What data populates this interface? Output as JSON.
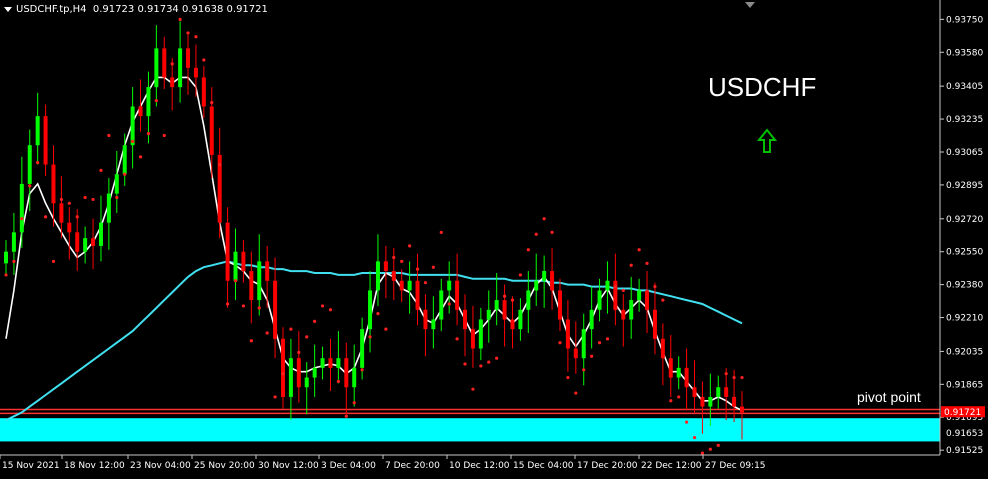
{
  "header": {
    "symbol": "USDCHF.tp,H4",
    "open": "0.91723",
    "high": "0.91734",
    "low": "0.91638",
    "close": "0.91721"
  },
  "annotations": {
    "title": "USDCHF",
    "pivot_label": "pivot point",
    "arrow_icon": "up-arrow-icon",
    "arrow_color": "#00c000"
  },
  "colors": {
    "background": "#000000",
    "bull_candle": "#00ff00",
    "bear_candle": "#ff0000",
    "sma_fast": "#ffffff",
    "sma_slow": "#40e0f0",
    "sar_dots": "#ff2020",
    "pivot_zone": "#00ffff",
    "pivot_lines": "#ff3030",
    "price_label_bg": "#ff0000"
  },
  "chart_data": {
    "type": "candlestick",
    "timeframe": "H4",
    "ylim": [
      0.915,
      0.9385
    ],
    "y_ticks": [
      "0.93750",
      "0.93580",
      "0.93405",
      "0.93235",
      "0.93065",
      "0.92895",
      "0.92720",
      "0.92550",
      "0.92380",
      "0.92210",
      "0.92035",
      "0.91865",
      "0.91695",
      "0.91525"
    ],
    "x_ticks": [
      "15 Nov 2021",
      "18 Nov 12:00",
      "23 Nov 04:00",
      "25 Nov 20:00",
      "30 Nov 12:00",
      "3 Dec 04:00",
      "7 Dec 20:00",
      "10 Dec 12:00",
      "15 Dec 04:00",
      "17 Dec 20:00",
      "22 Dec 12:00",
      "27 Dec 09:15"
    ],
    "current_price": "0.91721",
    "current_price_label": "0.91721",
    "pivot_zone_label": "0.91653",
    "pivot_zone": [
      0.9157,
      0.9169
    ],
    "pivot_lines": [
      0.91735,
      0.91715
    ],
    "closes": [
      0.9255,
      0.9265,
      0.929,
      0.931,
      0.9325,
      0.93,
      0.928,
      0.927,
      0.9265,
      0.9255,
      0.9262,
      0.9258,
      0.927,
      0.9285,
      0.9295,
      0.931,
      0.933,
      0.9325,
      0.934,
      0.936,
      0.9345,
      0.934,
      0.936,
      0.935,
      0.9345,
      0.933,
      0.9305,
      0.927,
      0.924,
      0.9255,
      0.9245,
      0.923,
      0.925,
      0.924,
      0.921,
      0.918,
      0.92,
      0.9185,
      0.919,
      0.9195,
      0.92,
      0.9195,
      0.92,
      0.9185,
      0.9195,
      0.9215,
      0.9235,
      0.925,
      0.9245,
      0.924,
      0.9235,
      0.924,
      0.9225,
      0.9215,
      0.922,
      0.9235,
      0.924,
      0.9225,
      0.9215,
      0.9205,
      0.922,
      0.9225,
      0.923,
      0.922,
      0.9215,
      0.9225,
      0.9235,
      0.924,
      0.9245,
      0.9235,
      0.922,
      0.9205,
      0.92,
      0.9215,
      0.9225,
      0.9235,
      0.924,
      0.9225,
      0.922,
      0.923,
      0.9235,
      0.9225,
      0.921,
      0.92,
      0.919,
      0.9195,
      0.9185,
      0.918,
      0.9175,
      0.918,
      0.9185,
      0.918,
      0.9175,
      0.9172
    ],
    "fast_sma": [
      0.921,
      0.9235,
      0.9265,
      0.9285,
      0.929,
      0.928,
      0.9272,
      0.9265,
      0.9258,
      0.9252,
      0.9255,
      0.926,
      0.9268,
      0.928,
      0.9295,
      0.931,
      0.9322,
      0.933,
      0.9338,
      0.9345,
      0.9345,
      0.9342,
      0.9345,
      0.9345,
      0.934,
      0.932,
      0.9295,
      0.927,
      0.925,
      0.9248,
      0.9245,
      0.924,
      0.9238,
      0.923,
      0.9215,
      0.92,
      0.9195,
      0.9193,
      0.9193,
      0.9195,
      0.9196,
      0.9197,
      0.9196,
      0.9192,
      0.9195,
      0.9205,
      0.922,
      0.9238,
      0.9244,
      0.9242,
      0.9236,
      0.9234,
      0.9228,
      0.922,
      0.9218,
      0.9225,
      0.9232,
      0.9228,
      0.922,
      0.9212,
      0.9215,
      0.922,
      0.9226,
      0.9222,
      0.9218,
      0.9222,
      0.923,
      0.9238,
      0.9242,
      0.9236,
      0.9224,
      0.9212,
      0.9206,
      0.9212,
      0.922,
      0.923,
      0.9236,
      0.9228,
      0.9222,
      0.9226,
      0.923,
      0.9226,
      0.9214,
      0.9203,
      0.9193,
      0.9193,
      0.9188,
      0.9183,
      0.9178,
      0.9178,
      0.918,
      0.9178,
      0.9175,
      0.9173
    ],
    "slow_sma": [
      0.9168,
      0.917,
      0.9172,
      0.9175,
      0.9178,
      0.9181,
      0.9184,
      0.9187,
      0.919,
      0.9193,
      0.9196,
      0.9199,
      0.9202,
      0.9205,
      0.9208,
      0.9211,
      0.9214,
      0.9218,
      0.9222,
      0.9226,
      0.923,
      0.9234,
      0.9238,
      0.9242,
      0.9245,
      0.9247,
      0.9248,
      0.9249,
      0.925,
      0.9249,
      0.9248,
      0.9248,
      0.9247,
      0.9247,
      0.9246,
      0.9246,
      0.9245,
      0.9245,
      0.9245,
      0.9244,
      0.9244,
      0.9244,
      0.9243,
      0.9243,
      0.9243,
      0.9244,
      0.9244,
      0.9244,
      0.9244,
      0.9244,
      0.9244,
      0.9243,
      0.9243,
      0.9243,
      0.9243,
      0.9243,
      0.9243,
      0.9243,
      0.9242,
      0.9241,
      0.9241,
      0.9241,
      0.9241,
      0.9241,
      0.924,
      0.924,
      0.924,
      0.924,
      0.924,
      0.9239,
      0.9239,
      0.9238,
      0.9238,
      0.9238,
      0.9237,
      0.9237,
      0.9237,
      0.9236,
      0.9236,
      0.9236,
      0.9235,
      0.9235,
      0.9234,
      0.9233,
      0.9232,
      0.9231,
      0.923,
      0.9229,
      0.9228,
      0.9226,
      0.9224,
      0.9222,
      0.922,
      0.9218
    ]
  }
}
